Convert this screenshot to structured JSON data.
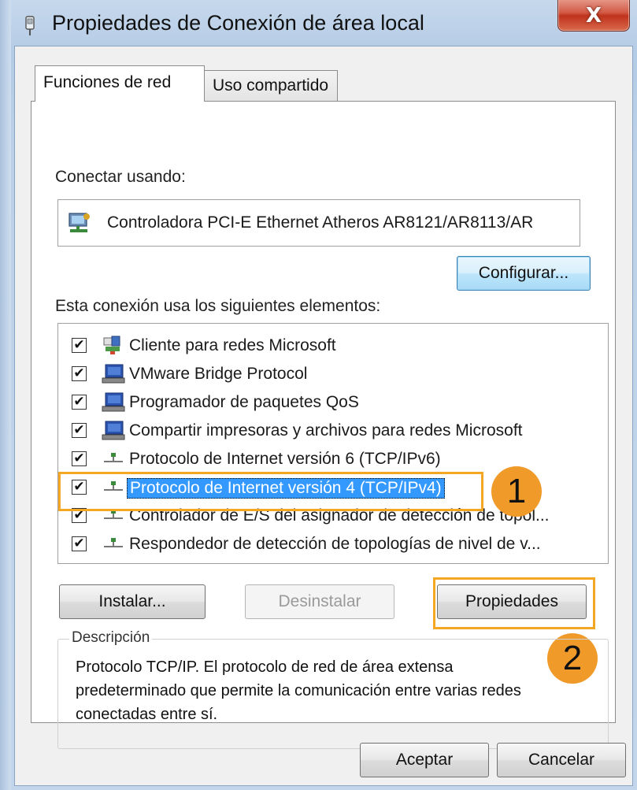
{
  "window": {
    "title": "Propiedades de Conexión de área local",
    "close_glyph": "X"
  },
  "tabs": [
    {
      "label": "Funciones de red",
      "active": true
    },
    {
      "label": "Uso compartido",
      "active": false
    }
  ],
  "connect_using": {
    "label": "Conectar usando:",
    "adapter": "Controladora PCI-E Ethernet Atheros AR8121/AR8113/AR",
    "adapter_icon": "network-adapter-icon",
    "configure_label": "Configurar..."
  },
  "items_label": "Esta conexión usa los siguientes elementos:",
  "items": [
    {
      "label": "Cliente para redes Microsoft",
      "checked": true,
      "icon": "network-client-icon",
      "selected": false
    },
    {
      "label": "VMware Bridge Protocol",
      "checked": true,
      "icon": "network-service-icon",
      "selected": false
    },
    {
      "label": "Programador de paquetes QoS",
      "checked": true,
      "icon": "network-service-icon",
      "selected": false
    },
    {
      "label": "Compartir impresoras y archivos para redes Microsoft",
      "checked": true,
      "icon": "network-service-icon",
      "selected": false
    },
    {
      "label": "Protocolo de Internet versión 6 (TCP/IPv6)",
      "checked": true,
      "icon": "protocol-icon",
      "selected": false
    },
    {
      "label": "Protocolo de Internet versión 4 (TCP/IPv4)",
      "checked": true,
      "icon": "protocol-icon",
      "selected": true
    },
    {
      "label": "Controlador de E/S del asignador de detección de topol...",
      "checked": true,
      "icon": "protocol-icon",
      "selected": false
    },
    {
      "label": "Respondedor de detección de topologías de nivel de v...",
      "checked": true,
      "icon": "protocol-icon",
      "selected": false
    }
  ],
  "buttons": {
    "install": "Instalar...",
    "uninstall": "Desinstalar",
    "properties": "Propiedades",
    "ok": "Aceptar",
    "cancel": "Cancelar"
  },
  "description": {
    "legend": "Descripción",
    "text": "Protocolo TCP/IP. El protocolo de red de área extensa predeterminado que permite la comunicación entre varias redes conectadas entre sí."
  },
  "annotations": {
    "step1": "1",
    "step2": "2",
    "accent_color": "#f5a623"
  },
  "check_glyph": "✔"
}
